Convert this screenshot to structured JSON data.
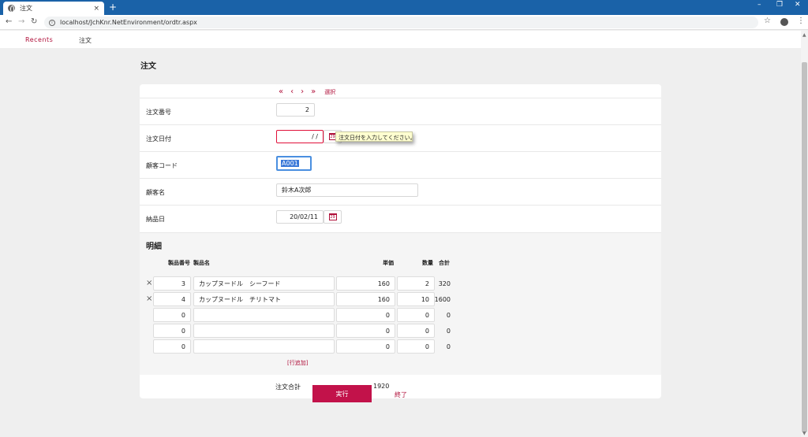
{
  "browser": {
    "tab_title": "注文",
    "tab_close": "×",
    "new_tab": "+",
    "url": "localhost/JchKnr.NetEnvironment/ordtr.aspx",
    "controls": {
      "minimize": "–",
      "restore": "❐",
      "close": "✕"
    }
  },
  "nav": {
    "recents": "Recents",
    "order": "注文"
  },
  "page": {
    "title": "注文"
  },
  "pager": {
    "first": "«",
    "prev": "‹",
    "next": "›",
    "last": "»",
    "select": "選択"
  },
  "form": {
    "order_no": {
      "label": "注文番号",
      "value": "2"
    },
    "order_date": {
      "label": "注文日付",
      "value": "/ /",
      "cal": "29",
      "tooltip": "注文日付を入力してください。"
    },
    "customer_code": {
      "label": "顧客コード",
      "value": "A001"
    },
    "customer_name": {
      "label": "顧客名",
      "value": "鈴木A次郎"
    },
    "delivery_date": {
      "label": "納品日",
      "value": "20/02/11",
      "cal": "29"
    }
  },
  "details": {
    "title": "明細",
    "columns": {
      "product_no": "製品番号",
      "product_name": "製品名",
      "unit_price": "単価",
      "qty": "数量",
      "total": "合計"
    },
    "delete_icon": "×",
    "rows": [
      {
        "no": "3",
        "name": "カップヌードル　シーフード",
        "price": "160",
        "qty": "2",
        "total": "320"
      },
      {
        "no": "4",
        "name": "カップヌードル　チリトマト",
        "price": "160",
        "qty": "10",
        "total": "1600"
      },
      {
        "no": "0",
        "name": "",
        "price": "0",
        "qty": "0",
        "total": "0"
      },
      {
        "no": "0",
        "name": "",
        "price": "0",
        "qty": "0",
        "total": "0"
      },
      {
        "no": "0",
        "name": "",
        "price": "0",
        "qty": "0",
        "total": "0"
      }
    ],
    "add_row": "[行追加]"
  },
  "summary": {
    "label": "注文合計",
    "value": "1920"
  },
  "actions": {
    "run": "実行",
    "end": "終了"
  },
  "colors": {
    "accent": "#b0103a",
    "primary_button": "#c2124a",
    "titlebar": "#1a62a8"
  }
}
